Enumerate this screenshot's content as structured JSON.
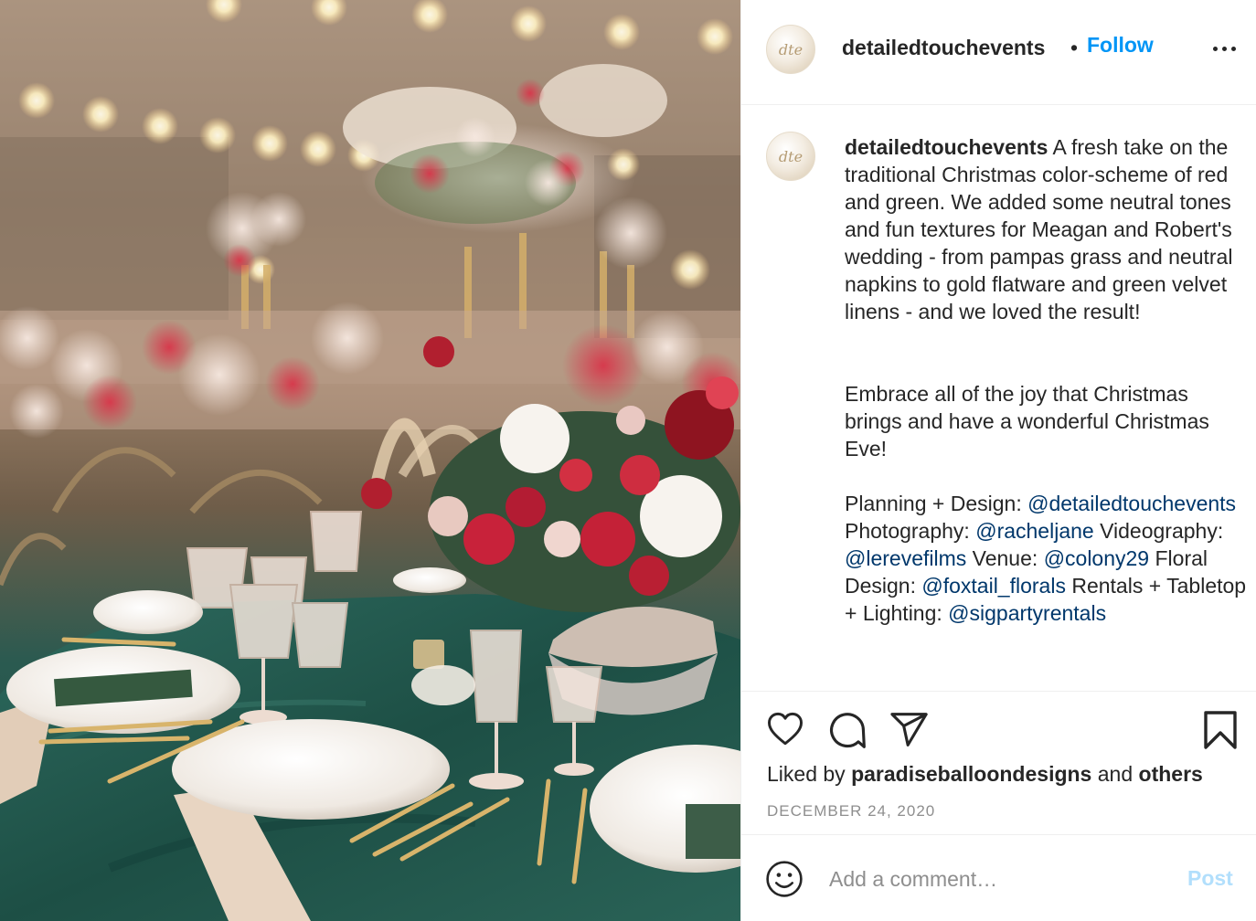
{
  "post": {
    "username": "detailedtouchevents",
    "separator": "•",
    "follow_label": "Follow",
    "avatar_initials": "dte",
    "more_icon": "more-options-icon"
  },
  "caption": {
    "username": "detailedtouchevents",
    "paragraph1": "A fresh take on the traditional Christmas color-scheme of red and green. We added some neutral tones and fun textures for Meagan and Robert's wedding - from pampas grass and neutral napkins to gold flatware and green velvet linens - and we loved the result!",
    "paragraph2": "Embrace all of the joy that Christmas brings and have a wonderful Christmas Eve!",
    "credits": {
      "planning_label": "Planning + Design:",
      "planning_mention": "@detailedtouchevents",
      "photography_label": "Photography:",
      "photography_mention": "@racheljane",
      "videography_label": "Videography:",
      "videography_mention": "@lerevefilms",
      "venue_label": "Venue:",
      "venue_mention": "@colony29",
      "floral_label": "Floral Design:",
      "floral_mention": "@foxtail_florals",
      "rentals_label": "Rentals + Tabletop + Lighting:",
      "rentals_mention": "@sigpartyrentals"
    }
  },
  "actions": {
    "like_icon": "heart-icon",
    "comment_icon": "comment-icon",
    "share_icon": "share-icon",
    "save_icon": "bookmark-icon",
    "liked_by_prefix": "Liked by",
    "liked_by_user": "paradiseballoondesigns",
    "liked_by_and": "and",
    "liked_by_others": "others",
    "date": "DECEMBER 24, 2020"
  },
  "comment_box": {
    "emoji_icon": "emoji-icon",
    "placeholder": "Add a comment…",
    "post_label": "Post"
  },
  "colors": {
    "follow": "#0095f6",
    "mention": "#00376b",
    "post_disabled": "#b2dffc",
    "meta": "#8e8e8e"
  }
}
